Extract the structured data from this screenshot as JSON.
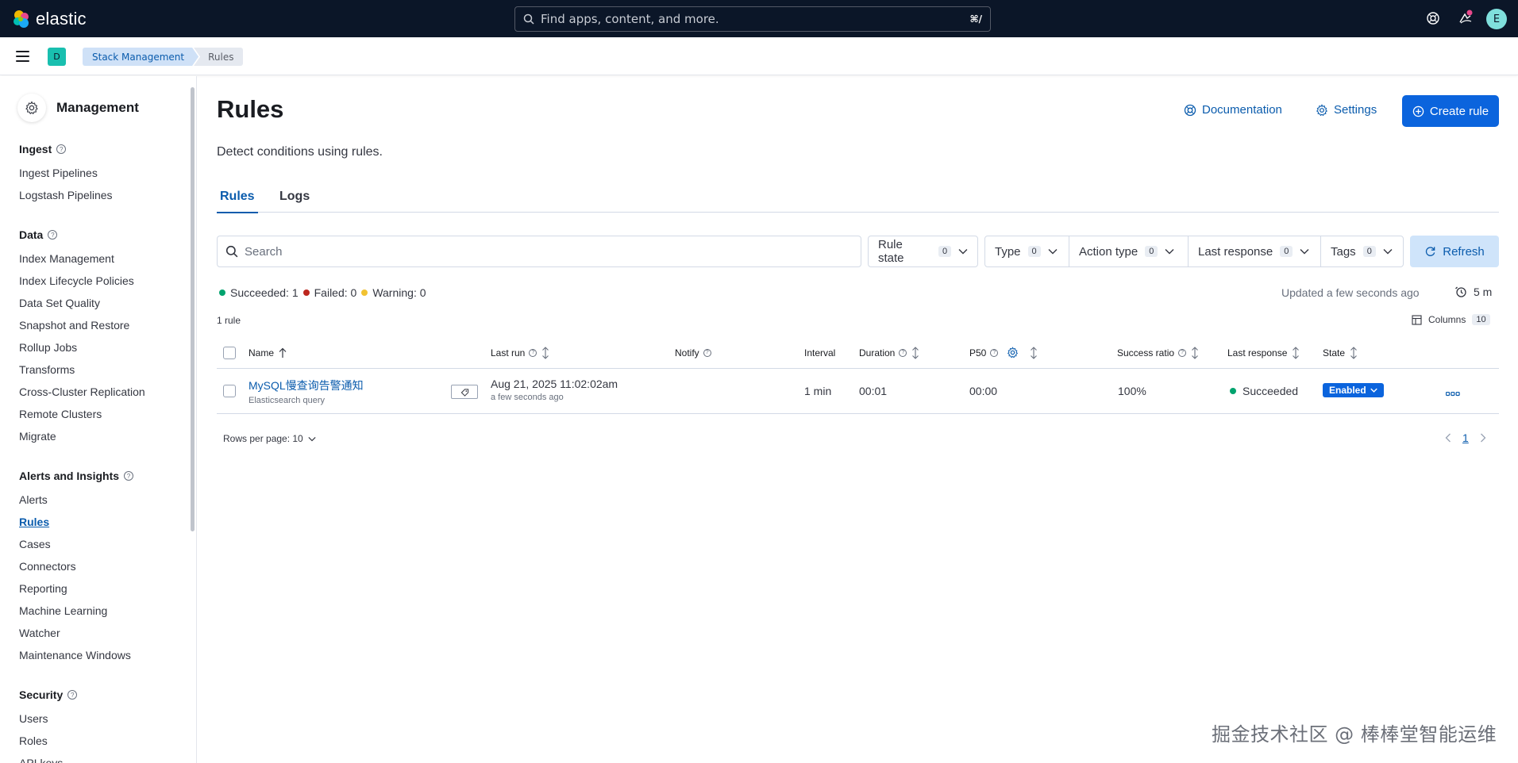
{
  "brand": {
    "name": "elastic"
  },
  "global_search": {
    "placeholder": "Find apps, content, and more.",
    "shortcut": "⌘/"
  },
  "user": {
    "initial": "E"
  },
  "space": {
    "initial": "D"
  },
  "breadcrumbs": [
    "Stack Management",
    "Rules"
  ],
  "sidebar": {
    "title": "Management",
    "groups": [
      {
        "title": "Ingest",
        "items": [
          "Ingest Pipelines",
          "Logstash Pipelines"
        ]
      },
      {
        "title": "Data",
        "items": [
          "Index Management",
          "Index Lifecycle Policies",
          "Data Set Quality",
          "Snapshot and Restore",
          "Rollup Jobs",
          "Transforms",
          "Cross-Cluster Replication",
          "Remote Clusters",
          "Migrate"
        ]
      },
      {
        "title": "Alerts and Insights",
        "items": [
          "Alerts",
          "Rules",
          "Cases",
          "Connectors",
          "Reporting",
          "Machine Learning",
          "Watcher",
          "Maintenance Windows"
        ]
      },
      {
        "title": "Security",
        "items": [
          "Users",
          "Roles",
          "API keys"
        ]
      }
    ],
    "active_item": "Rules"
  },
  "page": {
    "title": "Rules",
    "description": "Detect conditions using rules.",
    "documentation_label": "Documentation",
    "settings_label": "Settings",
    "create_label": "Create rule"
  },
  "tabs": [
    "Rules",
    "Logs"
  ],
  "search": {
    "placeholder": "Search"
  },
  "filters": [
    {
      "label": "Rule state",
      "count": "0"
    },
    {
      "label": "Type",
      "count": "0"
    },
    {
      "label": "Action type",
      "count": "0"
    },
    {
      "label": "Last response",
      "count": "0"
    },
    {
      "label": "Tags",
      "count": "0"
    }
  ],
  "refresh_label": "Refresh",
  "status": {
    "succeeded": "Succeeded: 1",
    "failed": "Failed: 0",
    "warning": "Warning: 0",
    "updated": "Updated a few seconds ago",
    "interval": "5 m"
  },
  "rule_count": "1 rule",
  "columns": {
    "label": "Columns",
    "count": "10"
  },
  "table": {
    "headers": [
      "Name",
      "Last run",
      "Notify",
      "Interval",
      "Duration",
      "P50",
      "Success ratio",
      "Last response",
      "State"
    ],
    "rows": [
      {
        "name": "MySQL慢查询告警通知",
        "type": "Elasticsearch query",
        "last_run": "Aug 21, 2025 11:02:02am",
        "last_run_rel": "a few seconds ago",
        "interval": "1 min",
        "duration": "00:01",
        "p50": "00:00",
        "success_ratio": "100%",
        "last_response": "Succeeded",
        "state": "Enabled"
      }
    ]
  },
  "pagination": {
    "rows_per_page": "Rows per page: 10",
    "page": "1"
  },
  "colors": {
    "accent": "#0b64dd",
    "success": "#00a36e",
    "danger": "#bd271e",
    "warning": "#f1c232",
    "header_bg": "#0b1628"
  },
  "watermark": "掘金技术社区 @ 棒棒堂智能运维"
}
